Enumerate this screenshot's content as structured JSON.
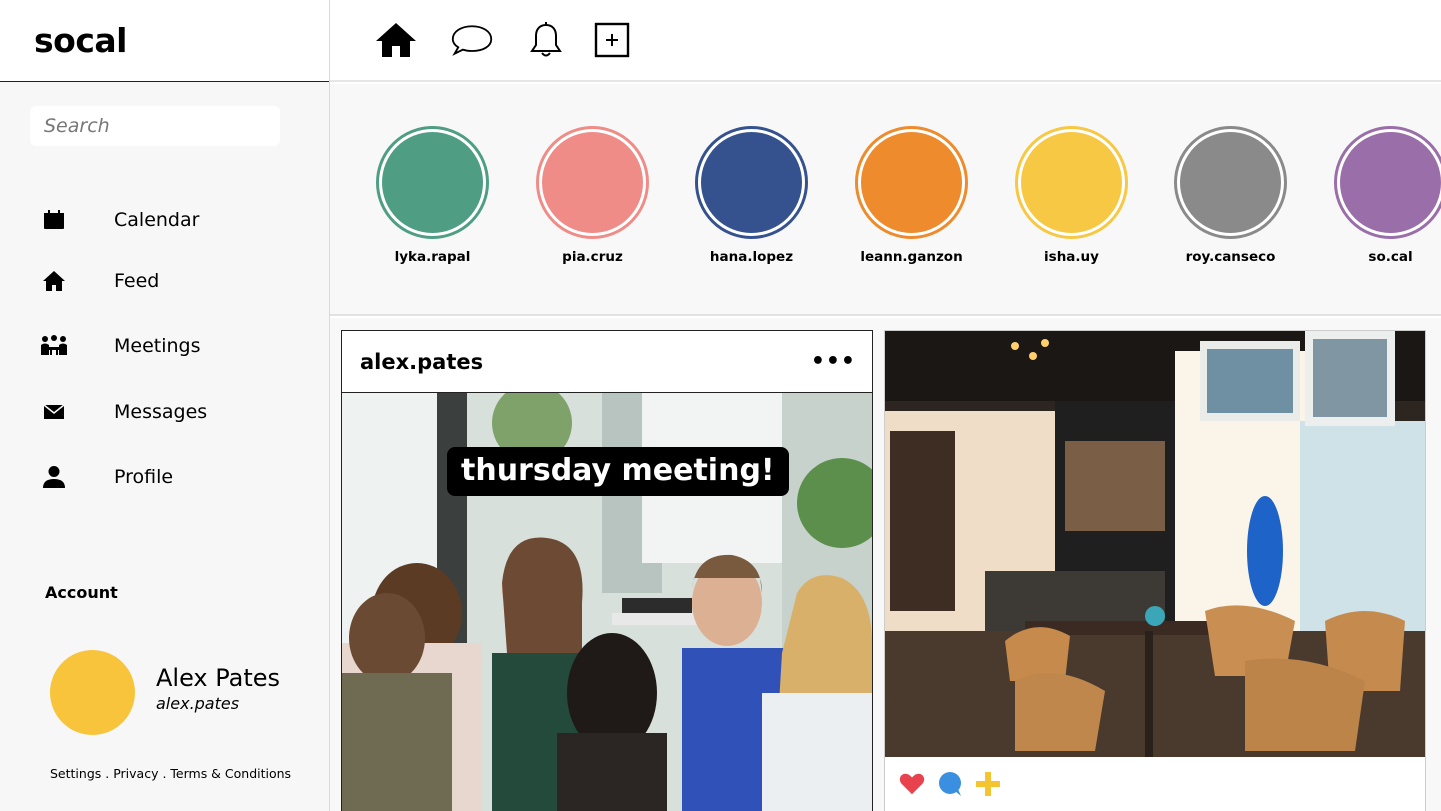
{
  "app": {
    "brand": "socal"
  },
  "search": {
    "placeholder": "Search"
  },
  "sidebar": {
    "items": [
      {
        "label": "Calendar",
        "icon": "calendar-icon"
      },
      {
        "label": "Feed",
        "icon": "home-icon"
      },
      {
        "label": "Meetings",
        "icon": "meeting-icon"
      },
      {
        "label": "Messages",
        "icon": "mail-icon"
      },
      {
        "label": "Profile",
        "icon": "person-icon"
      }
    ]
  },
  "account": {
    "title": "Account",
    "name": "Alex Pates",
    "handle": "alex.pates",
    "avatar_color": "#f7c43b",
    "links": [
      "Settings",
      " . ",
      "Privacy",
      " . ",
      "Terms & Conditions"
    ]
  },
  "topbar": {
    "icons": [
      "home-icon",
      "chat-bubble-icon",
      "bell-icon",
      "add-post-icon"
    ]
  },
  "stories": [
    {
      "user": "lyka.rapal",
      "color": "#4f9e84"
    },
    {
      "user": "pia.cruz",
      "color": "#ef8c87"
    },
    {
      "user": "hana.lopez",
      "color": "#35528e"
    },
    {
      "user": "leann.ganzon",
      "color": "#ee8b2d"
    },
    {
      "user": "isha.uy",
      "color": "#f7c843"
    },
    {
      "user": "roy.canseco",
      "color": "#8a8a8a"
    },
    {
      "user": "so.cal",
      "color": "#9a6ea9"
    }
  ],
  "posts": [
    {
      "user": "alex.pates",
      "more": "•••",
      "caption": "thursday meeting!"
    },
    {
      "actions": [
        "heart-icon",
        "comment-icon",
        "plus-icon"
      ]
    }
  ]
}
